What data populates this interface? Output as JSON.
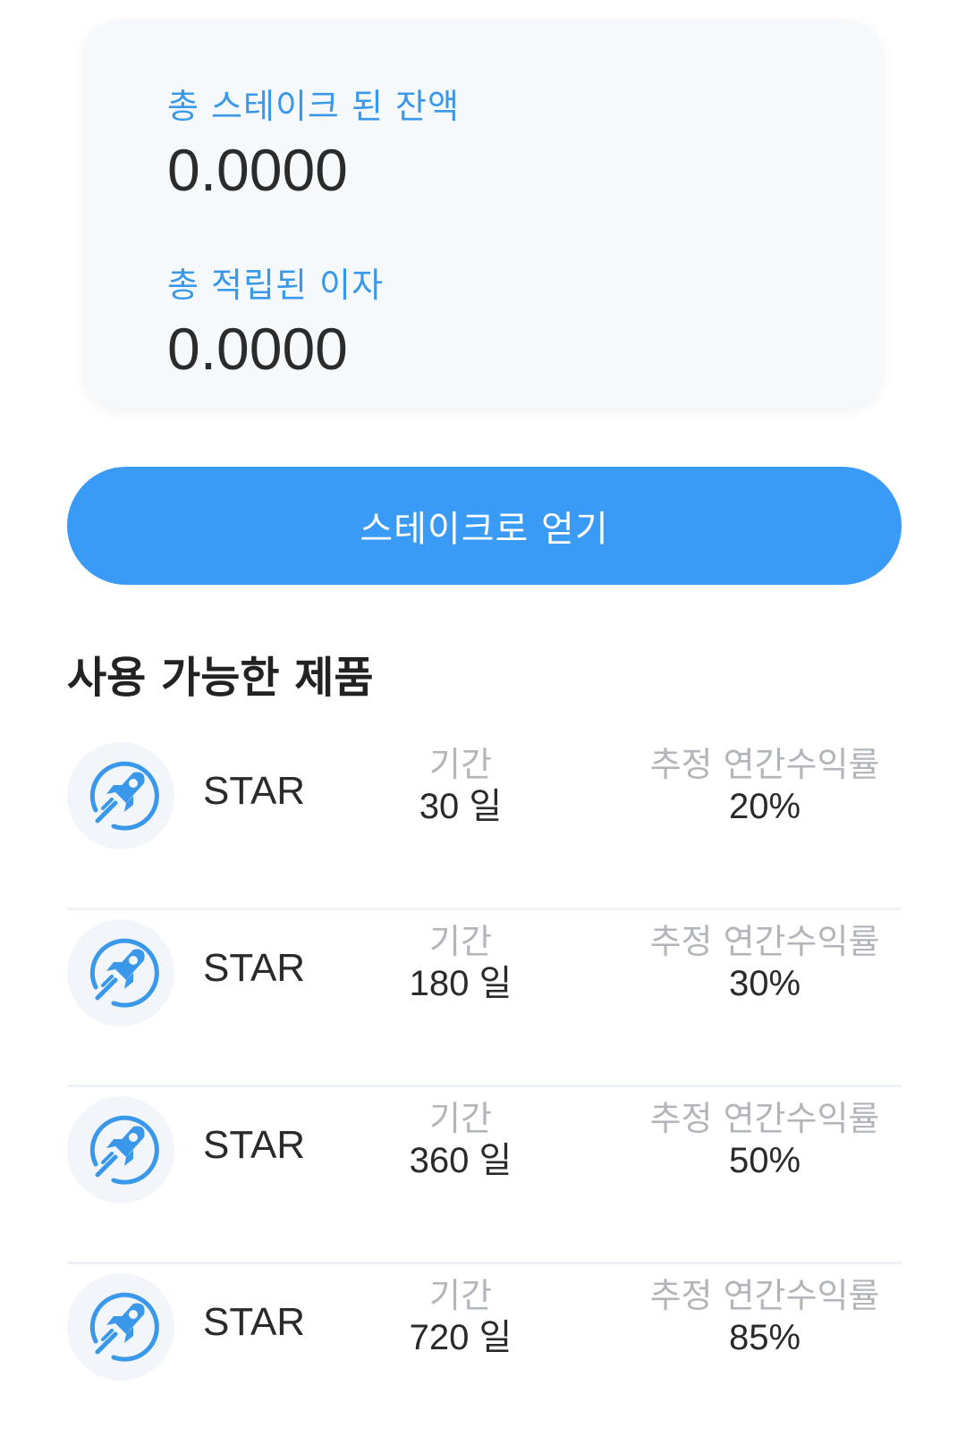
{
  "summary": {
    "staked_label": "총 스테이크 된 잔액",
    "staked_value": "0.0000",
    "interest_label": "총 적립된 이자",
    "interest_value": "0.0000"
  },
  "stake_button_label": "스테이크로 얻기",
  "products_title": "사용 가능한 제품",
  "colors": {
    "accent": "#3a9bf6",
    "label_blue": "#3a98ea",
    "card_bg": "#f6f9fc",
    "muted": "#b2b6bb"
  },
  "products": [
    {
      "icon": "rocket-icon",
      "name": "STAR",
      "period_label": "기간",
      "period": "30 일",
      "apy_label": "추정 연간수익률",
      "apy": "20%"
    },
    {
      "icon": "rocket-icon",
      "name": "STAR",
      "period_label": "기간",
      "period": "180 일",
      "apy_label": "추정 연간수익률",
      "apy": "30%"
    },
    {
      "icon": "rocket-icon",
      "name": "STAR",
      "period_label": "기간",
      "period": "360 일",
      "apy_label": "추정 연간수익률",
      "apy": "50%"
    },
    {
      "icon": "rocket-icon",
      "name": "STAR",
      "period_label": "기간",
      "period": "720 일",
      "apy_label": "추정 연간수익률",
      "apy": "85%"
    }
  ]
}
